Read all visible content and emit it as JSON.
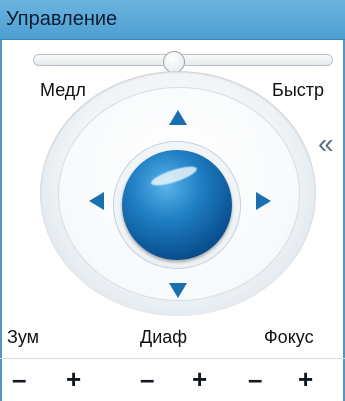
{
  "panel": {
    "title": "Управление"
  },
  "speed": {
    "slow_label": "Медл",
    "fast_label": "Быстр",
    "value_fraction": 0.47
  },
  "joystick": {
    "up_icon": "arrow-up-icon",
    "down_icon": "arrow-down-icon",
    "left_icon": "arrow-left-icon",
    "right_icon": "arrow-right-icon",
    "accent_color": "#1a6fb0",
    "ball_color": "#0b5495"
  },
  "collapse": {
    "glyph": "«",
    "icon": "double-chevron-left-icon"
  },
  "controls": {
    "zoom_label": "Зум",
    "iris_label": "Диаф",
    "focus_label": "Фокус",
    "minus_glyph": "–",
    "plus_glyph": "+"
  },
  "colors": {
    "titlebar": "#4e9fd2",
    "frame": "#4f97c8"
  }
}
